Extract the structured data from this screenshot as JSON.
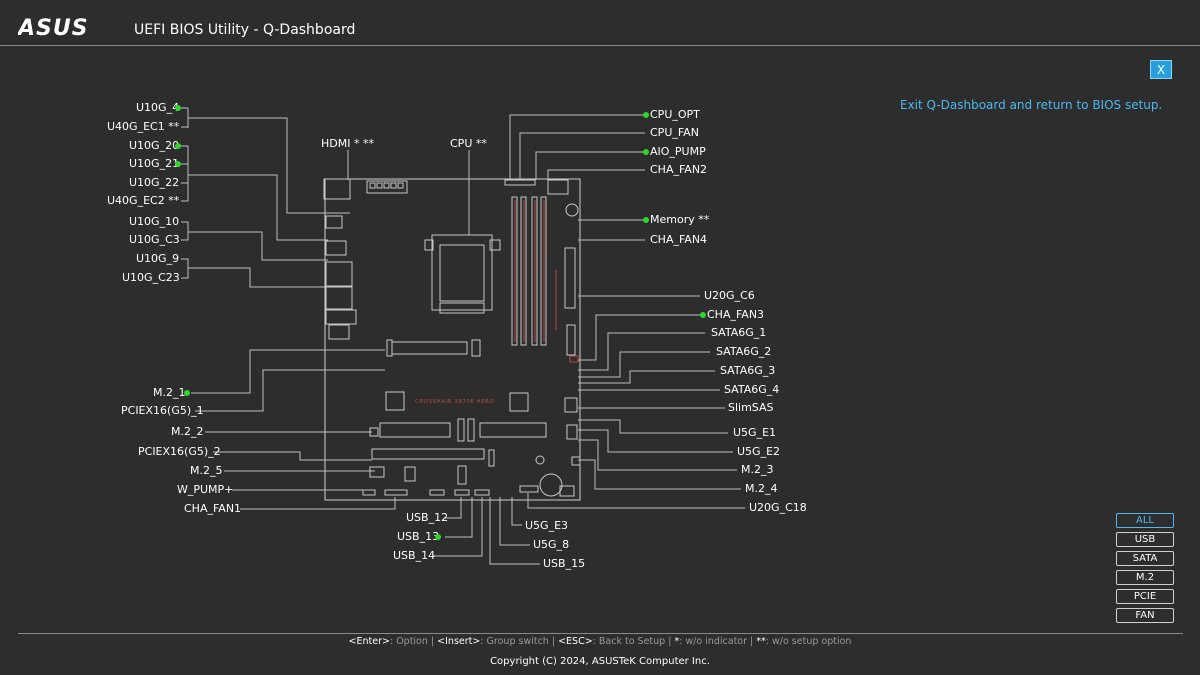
{
  "header": {
    "logo_text": "ASUS",
    "title": "UEFI BIOS Utility - Q-Dashboard"
  },
  "close_label": "X",
  "exit_message": "Exit Q-Dashboard and return to BIOS setup.",
  "board_silkscreen": "CROSSHAIR X870E HERO",
  "labels": {
    "u10g_4": "U10G_4",
    "u40g_ec1": "U40G_EC1 **",
    "u10g_20": "U10G_20",
    "u10g_21": "U10G_21",
    "u10g_22": "U10G_22",
    "u40g_ec2": "U40G_EC2 **",
    "u10g_10": "U10G_10",
    "u10g_c3": "U10G_C3",
    "u10g_9": "U10G_9",
    "u10g_c23": "U10G_C23",
    "hdmi": "HDMI * **",
    "cpu": "CPU **",
    "m2_1": "M.2_1",
    "pciex16_g5_1": "PCIEX16(G5)_1",
    "m2_2": "M.2_2",
    "pciex16_g5_2": "PCIEX16(G5)_2",
    "m2_5": "M.2_5",
    "w_pump": "W_PUMP+",
    "cha_fan1": "CHA_FAN1",
    "usb_12": "USB_12",
    "usb_13": "USB_13",
    "usb_14": "USB_14",
    "u5g_e3": "U5G_E3",
    "u5g_8": "U5G_8",
    "usb_15": "USB_15",
    "cpu_opt": "CPU_OPT",
    "cpu_fan": "CPU_FAN",
    "aio_pump": "AIO_PUMP",
    "cha_fan2": "CHA_FAN2",
    "memory": "Memory **",
    "cha_fan4": "CHA_FAN4",
    "u20g_c6": "U20G_C6",
    "cha_fan3": "CHA_FAN3",
    "sata6g_1": "SATA6G_1",
    "sata6g_2": "SATA6G_2",
    "sata6g_3": "SATA6G_3",
    "sata6g_4": "SATA6G_4",
    "slimsas": "SlimSAS",
    "u5g_e1": "U5G_E1",
    "u5g_e2": "U5G_E2",
    "m2_3": "M.2_3",
    "m2_4": "M.2_4",
    "u20g_c18": "U20G_C18"
  },
  "indicator_color": "#2cd82c",
  "accent_color": "#4cb8ef",
  "filters": [
    "ALL",
    "USB",
    "SATA",
    "M.2",
    "PCIE",
    "FAN"
  ],
  "active_filter": "ALL",
  "hints": {
    "enter_key": "<Enter>",
    "enter_desc": ": Option",
    "insert_key": "<Insert>",
    "insert_desc": ": Group switch",
    "esc_key": "<ESC>",
    "esc_desc": ": Back to Setup",
    "star_key": "*",
    "star_desc": ": w/o indicator",
    "dstar_key": "**",
    "dstar_desc": ": w/o setup option",
    "sep": " | "
  },
  "copyright": "Copyright (C) 2024, ASUSTeK Computer Inc."
}
